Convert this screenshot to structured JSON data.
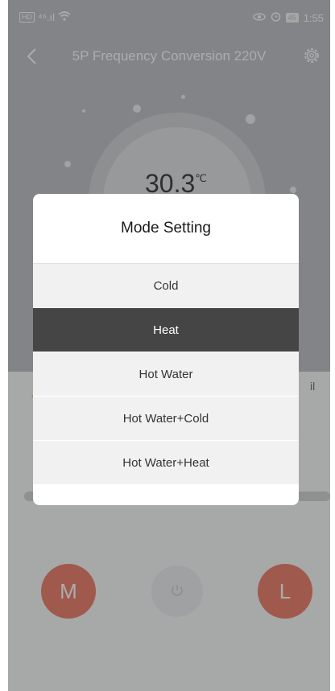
{
  "status_bar": {
    "left_chip": "HD",
    "signal": "⁴⁶.ıl",
    "right_chip": "45",
    "time": "1:55"
  },
  "header": {
    "title": "5P Frequency Conversion 220V"
  },
  "temperature": {
    "value": "30.3",
    "unit": "℃"
  },
  "page_snippet": "il",
  "buttons": {
    "mode": "M",
    "fan": "L"
  },
  "modal": {
    "title": "Mode Setting",
    "selected": "Heat",
    "options": [
      {
        "label": "Cold",
        "selected": false
      },
      {
        "label": "Heat",
        "selected": true
      },
      {
        "label": "Hot Water",
        "selected": false
      },
      {
        "label": "Hot Water+Cold",
        "selected": false
      },
      {
        "label": "Hot Water+Heat",
        "selected": false
      }
    ]
  },
  "colors": {
    "accent_red": "#e86a52",
    "selected_bg": "#454545",
    "option_bg": "#f1f1f1"
  }
}
